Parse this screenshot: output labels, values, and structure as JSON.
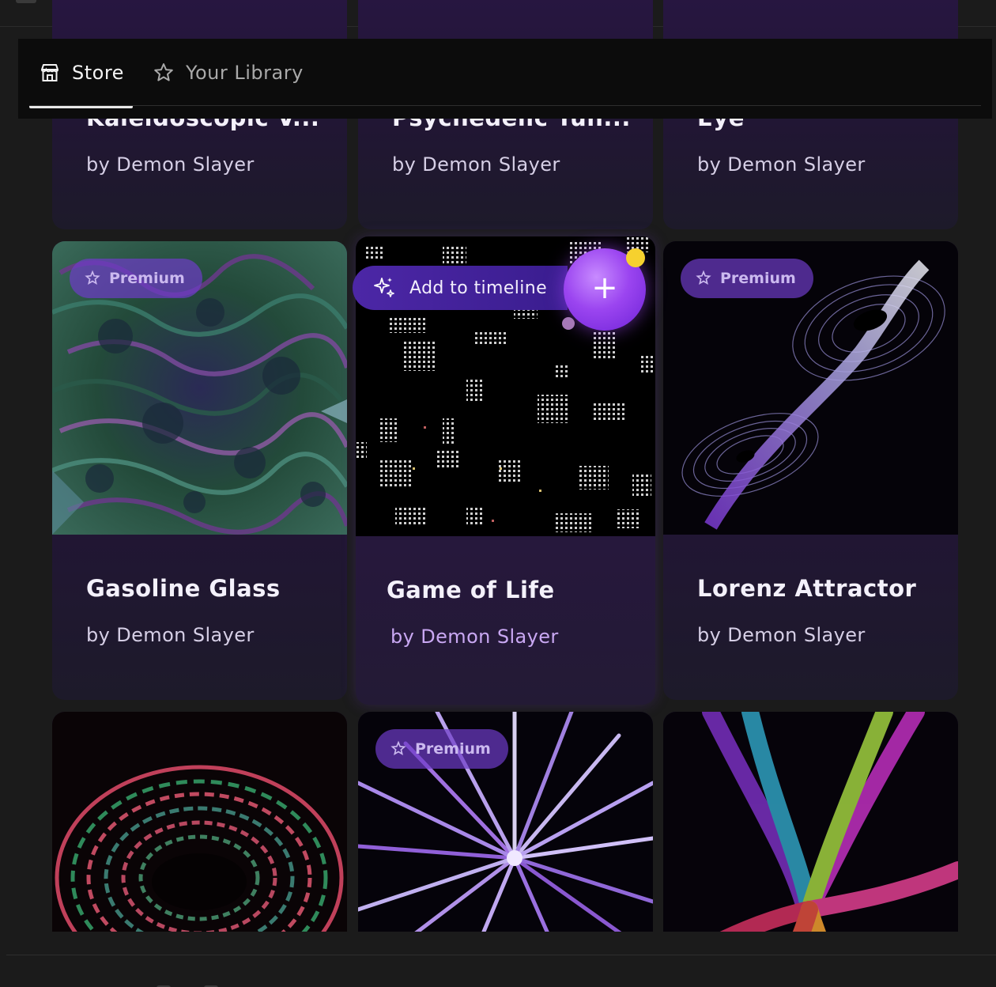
{
  "tabs": [
    {
      "label": "Store",
      "icon": "store-icon",
      "active": true
    },
    {
      "label": "Your Library",
      "icon": "star-outline-icon",
      "active": false
    }
  ],
  "badge_label": "Premium",
  "hover_action": {
    "label": "Add to timeline",
    "icon": "sparkle-icon",
    "plus": "+"
  },
  "cards": [
    {
      "title": "Kaleidoscopic V...",
      "author": "by Demon Slayer"
    },
    {
      "title": "Psychedelic Tun...",
      "author": "by Demon Slayer"
    },
    {
      "title": "Eye",
      "author": "by Demon Slayer"
    },
    {
      "title": "Gasoline Glass",
      "author": "by Demon Slayer",
      "premium": true
    },
    {
      "title": "Game of Life",
      "author": "by Demon Slayer",
      "premium": false
    },
    {
      "title": "Lorenz Attractor",
      "author": "by Demon Slayer",
      "premium": true
    },
    {
      "title": "",
      "author": "",
      "premium": false
    },
    {
      "title": "",
      "author": "",
      "premium": true
    },
    {
      "title": "",
      "author": "",
      "premium": false
    }
  ],
  "colors": {
    "card_purple": "#2a1747",
    "badge_purple": "#6e3cc8",
    "accent_orb": "#9b45f0",
    "notify_dot": "#f6d12e"
  }
}
